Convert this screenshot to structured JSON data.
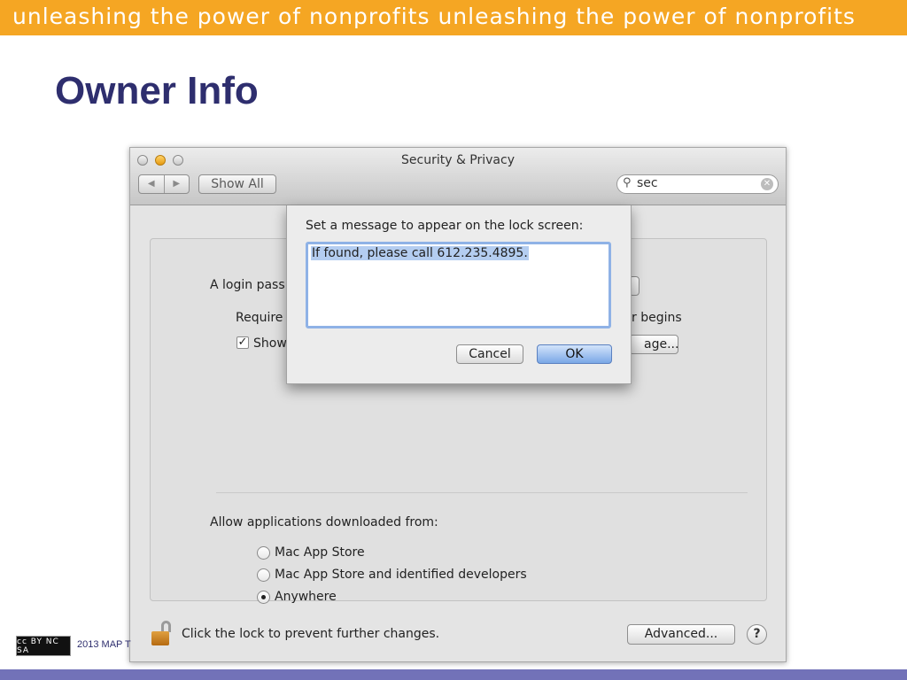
{
  "slide": {
    "banner_text": "unleashing the power of nonprofits unleashing the power of nonprofits",
    "title": "Owner Info",
    "license_badge": "cc BY NC SA",
    "copyright": "2013 MAP T"
  },
  "window": {
    "title": "Security & Privacy",
    "nav_back": "◀",
    "nav_forward": "▶",
    "show_all_label": "Show All",
    "search_value": "sec",
    "search_clear_glyph": "✕",
    "search_icon_glyph": "⚲"
  },
  "panel": {
    "login_label_partial": "A login pass",
    "require_partial": "Require",
    "begins_partial": "r begins",
    "show_partial": "Show",
    "message_button_partial": "age...",
    "allow_label": "Allow applications downloaded from:",
    "options": [
      {
        "label": "Mac App Store",
        "selected": false
      },
      {
        "label": "Mac App Store and identified developers",
        "selected": false
      },
      {
        "label": "Anywhere",
        "selected": true
      }
    ]
  },
  "footer": {
    "lock_text": "Click the lock to prevent further changes.",
    "advanced_label": "Advanced...",
    "help_label": "?"
  },
  "sheet": {
    "prompt": "Set a message to appear on the lock screen:",
    "message_value": "If found, please call 612.235.4895.",
    "cancel_label": "Cancel",
    "ok_label": "OK"
  },
  "colors": {
    "banner": "#f5a623",
    "title": "#2e2e6e",
    "bottom_bar": "#7272b8",
    "selection": "#b4cdf0"
  }
}
